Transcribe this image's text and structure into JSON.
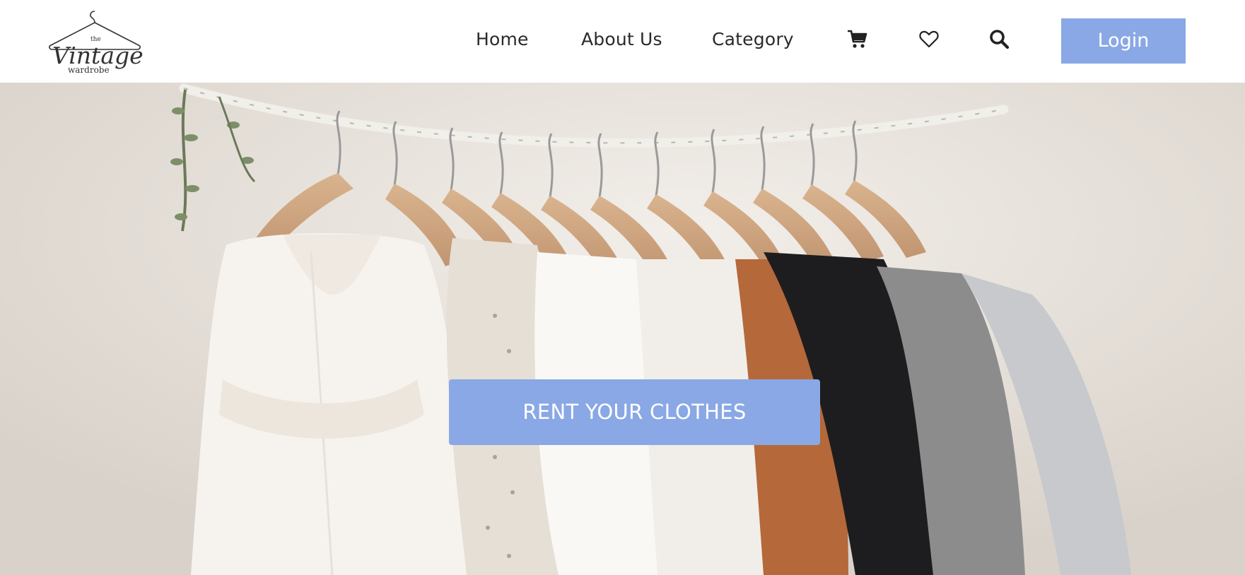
{
  "brand": {
    "logo_icon": "hanger-icon",
    "logo_top": "the",
    "logo_main": "Vintage",
    "logo_bottom": "wardrobe"
  },
  "nav": {
    "items": [
      {
        "label": "Home"
      },
      {
        "label": "About Us"
      },
      {
        "label": "Category"
      }
    ],
    "icons": {
      "cart": "cart-icon",
      "wishlist": "heart-icon",
      "search": "search-icon"
    },
    "login_label": "Login"
  },
  "hero": {
    "image": "clothes-on-hangers-photo",
    "cta_label": "RENT YOUR CLOTHES"
  },
  "colors": {
    "accent": "#89a8e5",
    "text": "#2a2a2a",
    "background": "#ffffff"
  }
}
